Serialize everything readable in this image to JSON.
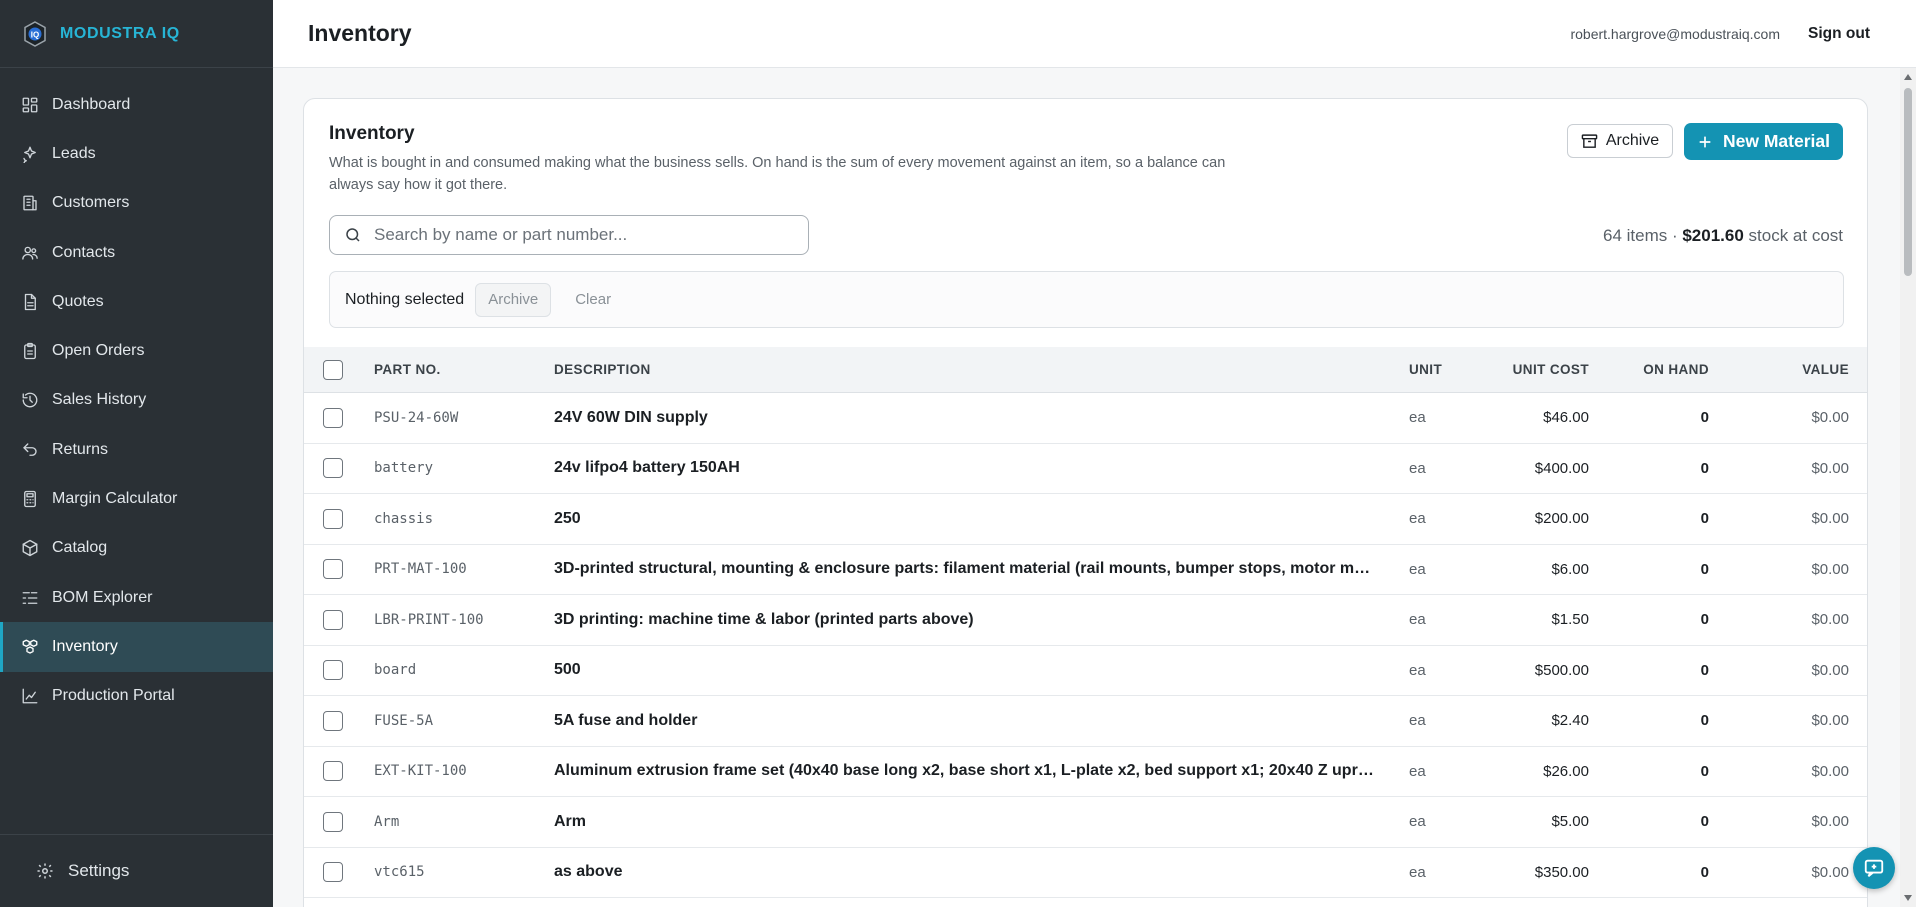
{
  "app": {
    "brand": "MODUSTRA IQ",
    "logo_text": "IQ",
    "accent": "#1493b3",
    "brand_color": "#27b5d6"
  },
  "sidebar": {
    "items": [
      {
        "label": "Dashboard",
        "icon": "dashboard-icon"
      },
      {
        "label": "Leads",
        "icon": "sparkles-icon"
      },
      {
        "label": "Customers",
        "icon": "building-icon"
      },
      {
        "label": "Contacts",
        "icon": "people-icon"
      },
      {
        "label": "Quotes",
        "icon": "document-icon"
      },
      {
        "label": "Open Orders",
        "icon": "clipboard-icon"
      },
      {
        "label": "Sales History",
        "icon": "history-icon"
      },
      {
        "label": "Returns",
        "icon": "return-arrow-icon"
      },
      {
        "label": "Margin Calculator",
        "icon": "calculator-icon"
      },
      {
        "label": "Catalog",
        "icon": "box-icon"
      },
      {
        "label": "BOM Explorer",
        "icon": "list-tree-icon"
      },
      {
        "label": "Inventory",
        "icon": "boxes-icon",
        "active": true
      },
      {
        "label": "Production Portal",
        "icon": "chart-icon"
      }
    ],
    "settings_label": "Settings"
  },
  "header": {
    "title": "Inventory",
    "user_email": "robert.hargrove@modustraiq.com",
    "sign_out": "Sign out"
  },
  "card": {
    "title": "Inventory",
    "description": "What is bought in and consumed making what the business sells. On hand is the sum of every movement against an item, so a balance can always say how it got there.",
    "archive_label": "Archive",
    "new_label": "New Material",
    "search_placeholder": "Search by name or part number...",
    "summary_count": "64 items · ",
    "summary_value": "$201.60",
    "summary_suffix": " stock at cost",
    "selection": {
      "status": "Nothing selected",
      "archive": "Archive",
      "clear": "Clear"
    }
  },
  "table": {
    "columns": {
      "part": "PART NO.",
      "desc": "DESCRIPTION",
      "unit": "UNIT",
      "cost": "UNIT COST",
      "onhand": "ON HAND",
      "value": "VALUE"
    },
    "rows": [
      {
        "part": "PSU-24-60W",
        "desc": "24V 60W DIN supply",
        "unit": "ea",
        "cost": "$46.00",
        "onhand": "0",
        "value": "$0.00"
      },
      {
        "part": "battery",
        "desc": "24v lifpo4 battery 150AH",
        "unit": "ea",
        "cost": "$400.00",
        "onhand": "0",
        "value": "$0.00"
      },
      {
        "part": "chassis",
        "desc": "250",
        "unit": "ea",
        "cost": "$200.00",
        "onhand": "0",
        "value": "$0.00"
      },
      {
        "part": "PRT-MAT-100",
        "desc": "3D-printed structural, mounting & enclosure parts: filament material (rail mounts, bumper stops, motor mou...",
        "unit": "ea",
        "cost": "$6.00",
        "onhand": "0",
        "value": "$0.00"
      },
      {
        "part": "LBR-PRINT-100",
        "desc": "3D printing: machine time & labor (printed parts above)",
        "unit": "ea",
        "cost": "$1.50",
        "onhand": "0",
        "value": "$0.00"
      },
      {
        "part": "board",
        "desc": "500",
        "unit": "ea",
        "cost": "$500.00",
        "onhand": "0",
        "value": "$0.00"
      },
      {
        "part": "FUSE-5A",
        "desc": "5A fuse and holder",
        "unit": "ea",
        "cost": "$2.40",
        "onhand": "0",
        "value": "$0.00"
      },
      {
        "part": "EXT-KIT-100",
        "desc": "Aluminum extrusion frame set (40x40 base long x2, base short x1, L-plate x2, bed support x1; 20x40 Z uprigh...",
        "unit": "ea",
        "cost": "$26.00",
        "onhand": "0",
        "value": "$0.00"
      },
      {
        "part": "Arm",
        "desc": "Arm",
        "unit": "ea",
        "cost": "$5.00",
        "onhand": "0",
        "value": "$0.00"
      },
      {
        "part": "vtc615",
        "desc": "as above",
        "unit": "ea",
        "cost": "$350.00",
        "onhand": "0",
        "value": "$0.00"
      }
    ]
  }
}
